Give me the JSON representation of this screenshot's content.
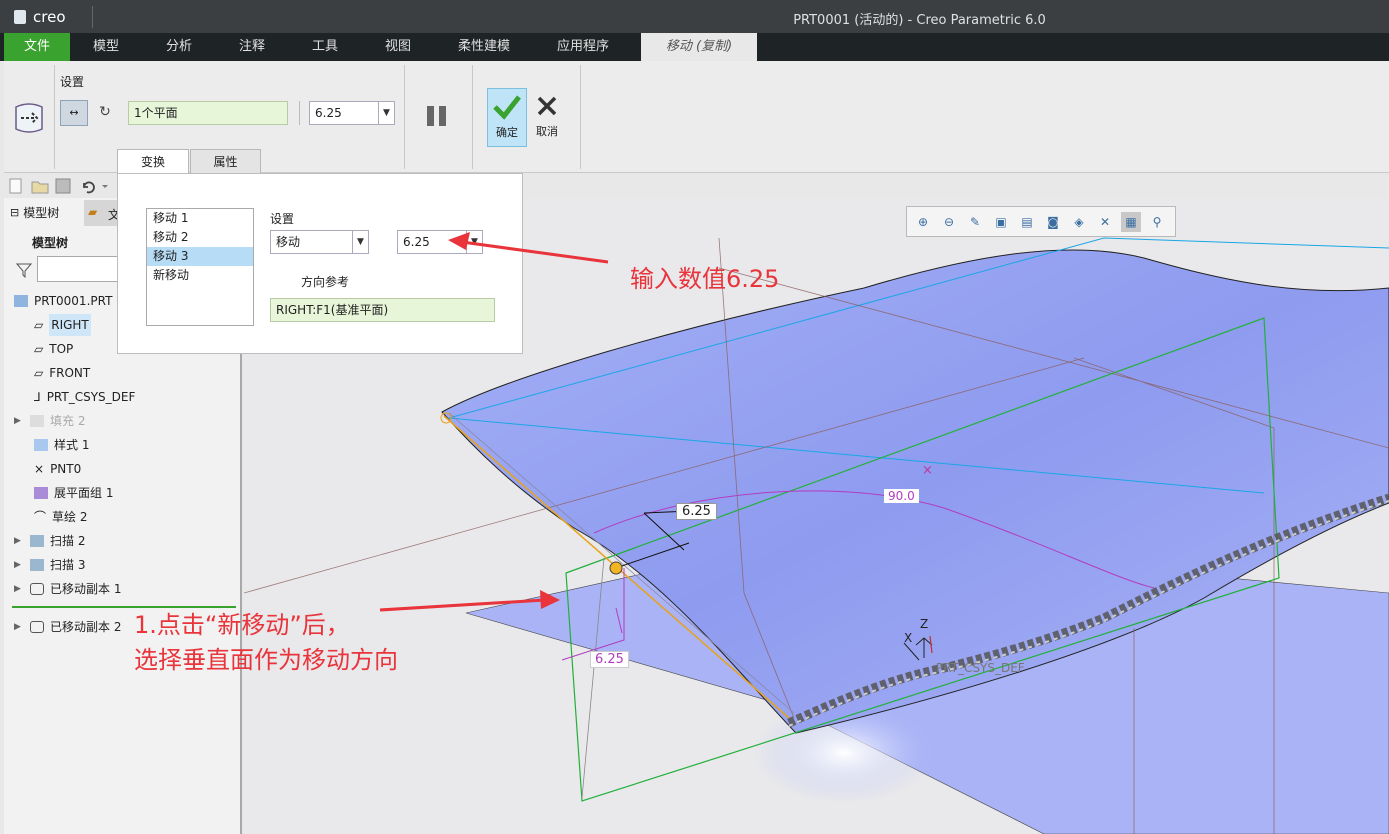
{
  "app": {
    "logo": "creo",
    "window_title": "PRT0001 (活动的) - Creo Parametric 6.0"
  },
  "menu": {
    "file": "文件",
    "model": "模型",
    "analysis": "分析",
    "annotate": "注释",
    "tools": "工具",
    "view": "视图",
    "flexible": "柔性建模",
    "apps": "应用程序",
    "active_tab": "移动 (复制)"
  },
  "ribbon": {
    "settings_label": "设置",
    "ref_field": "1个平面",
    "distance_value": "6.25",
    "confirm_label": "确定",
    "cancel_label": "取消"
  },
  "subtabs": {
    "transform": "变换",
    "properties": "属性"
  },
  "panel": {
    "moves": [
      "移动 1",
      "移动 2",
      "移动 3",
      "新移动"
    ],
    "settings_label": "设置",
    "type_value": "移动",
    "distance_value": "6.25",
    "direction_label": "方向参考",
    "direction_value": "RIGHT:F1(基准平面)"
  },
  "left_pane": {
    "tab_model_tree": "模型树",
    "tab_folder": "文",
    "header": "模型树",
    "items": [
      {
        "label": "PRT0001.PRT"
      },
      {
        "label": "RIGHT"
      },
      {
        "label": "TOP"
      },
      {
        "label": "FRONT"
      },
      {
        "label": "PRT_CSYS_DEF"
      },
      {
        "label": "填充 2"
      },
      {
        "label": "样式 1"
      },
      {
        "label": "PNT0"
      },
      {
        "label": "展平面组 1"
      },
      {
        "label": "草绘 2"
      },
      {
        "label": "扫描 2"
      },
      {
        "label": "扫描 3"
      },
      {
        "label": "已移动副本 1"
      },
      {
        "label": "已移动副本 2"
      }
    ]
  },
  "viewport": {
    "dim_top": "6.25",
    "dim_bottom": "6.25",
    "angle": "90.0",
    "csys_label": "PRT_CSYS_DEF",
    "axis_z": "Z",
    "axis_x": "X"
  },
  "annotations": {
    "top": "输入数值6.25",
    "bottom_line1": "1.点击“新移动”后，",
    "bottom_line2": "选择垂直面作为移动方向"
  },
  "colors": {
    "accent_green": "#3aa22e",
    "annotation_red": "#e8343a",
    "surface_blue": "#8f9cf2"
  }
}
